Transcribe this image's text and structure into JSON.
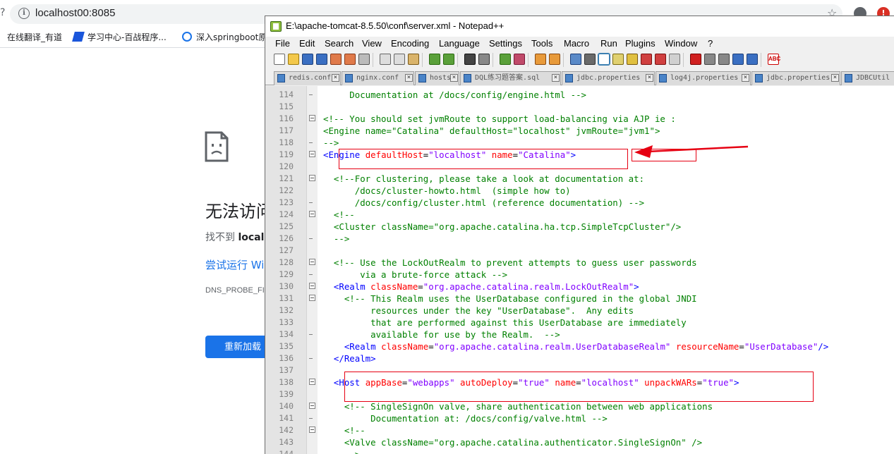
{
  "browser": {
    "back_fragment": "?",
    "url": "localhost00:8085",
    "bookmarks": [
      {
        "label": "在线翻译_有道"
      },
      {
        "label": "学习中心-百战程序..."
      },
      {
        "label": "深入springboot原"
      }
    ],
    "error": {
      "title": "无法访问",
      "subtitle_prefix": "找不到 ",
      "subtitle_host": "local",
      "link": "尝试运行 Wi",
      "code": "DNS_PROBE_FIN",
      "reload": "重新加载"
    }
  },
  "npp": {
    "title": "E:\\apache-tomcat-8.5.50\\conf\\server.xml - Notepad++",
    "menu": [
      "File",
      "Edit",
      "Search",
      "View",
      "Encoding",
      "Language",
      "Settings",
      "Tools",
      "Macro",
      "Run",
      "Plugins",
      "Window",
      "?"
    ],
    "tabs": [
      "redis.conf",
      "nginx.conf",
      "hosts",
      "DQL练习题答案.sql",
      "jdbc.properties",
      "log4j.properties",
      "jdbc.properties",
      "JDBCUtil"
    ],
    "lines": [
      {
        "n": "114",
        "f": "dash",
        "t": [
          {
            "c": "c-com",
            "s": "     Documentation at /docs/config/engine.html -->"
          }
        ]
      },
      {
        "n": "115",
        "f": "",
        "t": []
      },
      {
        "n": "116",
        "f": "box",
        "t": [
          {
            "c": "c-com",
            "s": "<!-- You should set jvmRoute to support load-balancing via AJP ie :"
          }
        ]
      },
      {
        "n": "117",
        "f": "",
        "t": [
          {
            "c": "c-com",
            "s": "<Engine name=\"Catalina\" defaultHost=\"localhost\" jvmRoute=\"jvm1\">"
          }
        ]
      },
      {
        "n": "118",
        "f": "dash",
        "t": [
          {
            "c": "c-com",
            "s": "-->"
          }
        ]
      },
      {
        "n": "119",
        "f": "box",
        "t": [
          {
            "c": "c-tag",
            "s": "<Engine"
          },
          {
            "c": "c-plain",
            "s": " "
          },
          {
            "c": "c-attr",
            "s": "defaultHost"
          },
          {
            "c": "c-plain",
            "s": "="
          },
          {
            "c": "c-val",
            "s": "\"localhost\""
          },
          {
            "c": "c-plain",
            "s": " "
          },
          {
            "c": "c-attr",
            "s": "name"
          },
          {
            "c": "c-plain",
            "s": "="
          },
          {
            "c": "c-val",
            "s": "\"Catalina\""
          },
          {
            "c": "c-tag",
            "s": ">"
          }
        ]
      },
      {
        "n": "120",
        "f": "",
        "t": []
      },
      {
        "n": "121",
        "f": "box",
        "t": [
          {
            "c": "c-com",
            "s": "  <!--For clustering, please take a look at documentation at:"
          }
        ]
      },
      {
        "n": "122",
        "f": "",
        "t": [
          {
            "c": "c-com",
            "s": "      /docs/cluster-howto.html  (simple how to)"
          }
        ]
      },
      {
        "n": "123",
        "f": "dash",
        "t": [
          {
            "c": "c-com",
            "s": "      /docs/config/cluster.html (reference documentation) -->"
          }
        ]
      },
      {
        "n": "124",
        "f": "box",
        "t": [
          {
            "c": "c-com",
            "s": "  <!--"
          }
        ]
      },
      {
        "n": "125",
        "f": "",
        "t": [
          {
            "c": "c-com",
            "s": "  <Cluster className=\"org.apache.catalina.ha.tcp.SimpleTcpCluster\"/>"
          }
        ]
      },
      {
        "n": "126",
        "f": "dash",
        "t": [
          {
            "c": "c-com",
            "s": "  -->"
          }
        ]
      },
      {
        "n": "127",
        "f": "",
        "t": []
      },
      {
        "n": "128",
        "f": "box",
        "t": [
          {
            "c": "c-com",
            "s": "  <!-- Use the LockOutRealm to prevent attempts to guess user passwords"
          }
        ]
      },
      {
        "n": "129",
        "f": "dash",
        "t": [
          {
            "c": "c-com",
            "s": "       via a brute-force attack -->"
          }
        ]
      },
      {
        "n": "130",
        "f": "box",
        "t": [
          {
            "c": "c-plain",
            "s": "  "
          },
          {
            "c": "c-tag",
            "s": "<Realm"
          },
          {
            "c": "c-plain",
            "s": " "
          },
          {
            "c": "c-attr",
            "s": "className"
          },
          {
            "c": "c-plain",
            "s": "="
          },
          {
            "c": "c-val",
            "s": "\"org.apache.catalina.realm.LockOutRealm\""
          },
          {
            "c": "c-tag",
            "s": ">"
          }
        ]
      },
      {
        "n": "131",
        "f": "box",
        "t": [
          {
            "c": "c-com",
            "s": "    <!-- This Realm uses the UserDatabase configured in the global JNDI"
          }
        ]
      },
      {
        "n": "132",
        "f": "",
        "t": [
          {
            "c": "c-com",
            "s": "         resources under the key \"UserDatabase\".  Any edits"
          }
        ]
      },
      {
        "n": "133",
        "f": "",
        "t": [
          {
            "c": "c-com",
            "s": "         that are performed against this UserDatabase are immediately"
          }
        ]
      },
      {
        "n": "134",
        "f": "dash",
        "t": [
          {
            "c": "c-com",
            "s": "         available for use by the Realm.  -->"
          }
        ]
      },
      {
        "n": "135",
        "f": "",
        "t": [
          {
            "c": "c-plain",
            "s": "    "
          },
          {
            "c": "c-tag",
            "s": "<Realm"
          },
          {
            "c": "c-plain",
            "s": " "
          },
          {
            "c": "c-attr",
            "s": "className"
          },
          {
            "c": "c-plain",
            "s": "="
          },
          {
            "c": "c-val",
            "s": "\"org.apache.catalina.realm.UserDatabaseRealm\""
          },
          {
            "c": "c-plain",
            "s": " "
          },
          {
            "c": "c-attr",
            "s": "resourceName"
          },
          {
            "c": "c-plain",
            "s": "="
          },
          {
            "c": "c-val",
            "s": "\"UserDatabase\""
          },
          {
            "c": "c-tag",
            "s": "/>"
          }
        ]
      },
      {
        "n": "136",
        "f": "dash",
        "t": [
          {
            "c": "c-plain",
            "s": "  "
          },
          {
            "c": "c-tag",
            "s": "</Realm>"
          }
        ]
      },
      {
        "n": "137",
        "f": "",
        "t": []
      },
      {
        "n": "138",
        "f": "box",
        "t": [
          {
            "c": "c-plain",
            "s": "  "
          },
          {
            "c": "c-tag",
            "s": "<Host"
          },
          {
            "c": "c-plain",
            "s": " "
          },
          {
            "c": "c-attr",
            "s": "appBase"
          },
          {
            "c": "c-plain",
            "s": "="
          },
          {
            "c": "c-val",
            "s": "\"webapps\""
          },
          {
            "c": "c-plain",
            "s": " "
          },
          {
            "c": "c-attr",
            "s": "autoDeploy"
          },
          {
            "c": "c-plain",
            "s": "="
          },
          {
            "c": "c-val",
            "s": "\"true\""
          },
          {
            "c": "c-plain",
            "s": " "
          },
          {
            "c": "c-attr",
            "s": "name"
          },
          {
            "c": "c-plain",
            "s": "="
          },
          {
            "c": "c-val",
            "s": "\"localhost\""
          },
          {
            "c": "c-plain",
            "s": " "
          },
          {
            "c": "c-attr",
            "s": "unpackWARs"
          },
          {
            "c": "c-plain",
            "s": "="
          },
          {
            "c": "c-val",
            "s": "\"true\""
          },
          {
            "c": "c-tag",
            "s": ">"
          }
        ]
      },
      {
        "n": "139",
        "f": "",
        "t": []
      },
      {
        "n": "140",
        "f": "box",
        "t": [
          {
            "c": "c-com",
            "s": "    <!-- SingleSignOn valve, share authentication between web applications"
          }
        ]
      },
      {
        "n": "141",
        "f": "dash",
        "t": [
          {
            "c": "c-com",
            "s": "         Documentation at: /docs/config/valve.html -->"
          }
        ]
      },
      {
        "n": "142",
        "f": "box",
        "t": [
          {
            "c": "c-com",
            "s": "    <!--"
          }
        ]
      },
      {
        "n": "143",
        "f": "",
        "t": [
          {
            "c": "c-com",
            "s": "    <Valve className=\"org.apache.catalina.authenticator.SingleSignOn\" />"
          }
        ]
      },
      {
        "n": "144",
        "f": "dash",
        "t": [
          {
            "c": "c-com",
            "s": "    -->"
          }
        ]
      }
    ]
  },
  "colors": {
    "annotation": "#e60012",
    "comment": "#008000",
    "tag": "#0000ff",
    "attribute": "#ff0000",
    "value": "#8000ff"
  }
}
